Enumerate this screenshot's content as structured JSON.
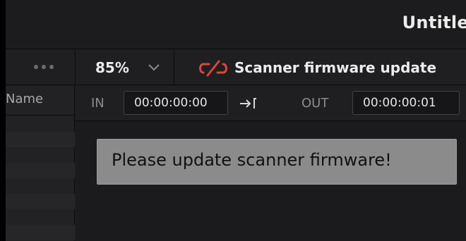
{
  "window": {
    "title": "Untitle"
  },
  "toolbar": {
    "zoom_value": "85%",
    "banner_text": "Scanner firmware update"
  },
  "left_panel": {
    "column_header": "Name"
  },
  "timecode": {
    "in_label": "IN",
    "in_value": "00:00:00:00",
    "out_label": "OUT",
    "out_value": "00:00:00:01"
  },
  "alert": {
    "message": "Please update scanner firmware!"
  },
  "icons": {
    "more": "more-horizontal-icon",
    "zoom_dropdown": "chevron-down-icon",
    "warning": "broken-link-icon",
    "in_out_arrow": "arrow-to-bracket-icon"
  },
  "colors": {
    "warning": "#e0443a",
    "alert_background": "#8b8b8b"
  }
}
